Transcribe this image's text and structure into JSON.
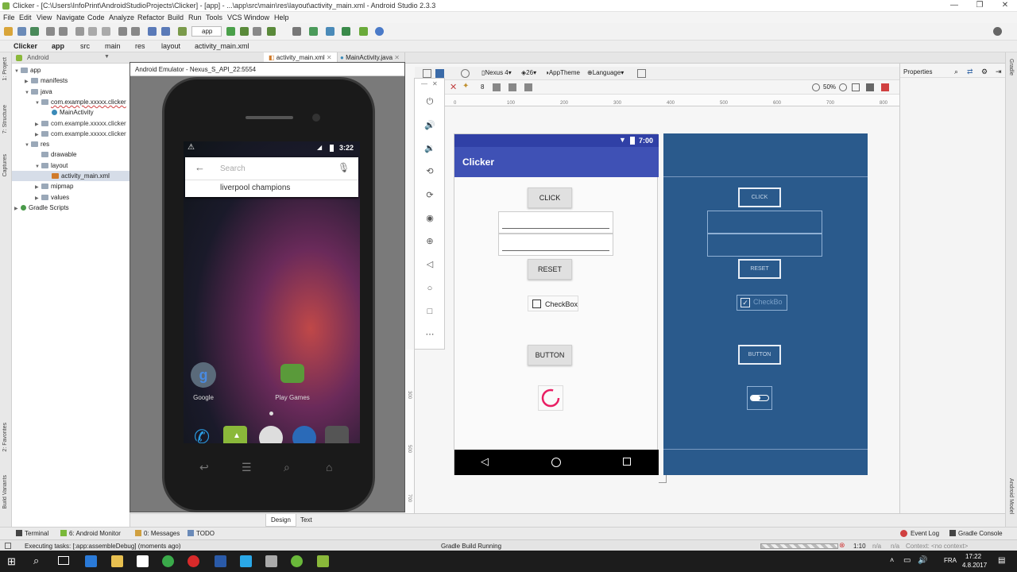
{
  "window": {
    "title": "Clicker - [C:\\Users\\InfoPrint\\AndroidStudioProjects\\Clicker] - [app] - ...\\app\\src\\main\\res\\layout\\activity_main.xml - Android Studio 2.3.3"
  },
  "menu": [
    "File",
    "Edit",
    "View",
    "Navigate",
    "Code",
    "Analyze",
    "Refactor",
    "Build",
    "Run",
    "Tools",
    "VCS",
    "Window",
    "Help"
  ],
  "toolbar": {
    "run_config": "app"
  },
  "breadcrumb": [
    "Clicker",
    "app",
    "src",
    "main",
    "res",
    "layout",
    "activity_main.xml"
  ],
  "project_panel": {
    "view_selector": "Android",
    "tree": [
      {
        "label": "app",
        "level": 0,
        "arrow": "▼"
      },
      {
        "label": "manifests",
        "level": 1,
        "arrow": "▶"
      },
      {
        "label": "java",
        "level": 1,
        "arrow": "▼"
      },
      {
        "label": "com.example.xxxxx.clicker",
        "level": 2,
        "arrow": "▼"
      },
      {
        "label": "MainActivity",
        "level": 3,
        "arrow": ""
      },
      {
        "label": "com.example.xxxxx.clicker",
        "level": 2,
        "arrow": "▶"
      },
      {
        "label": "com.example.xxxxx.clicker",
        "level": 2,
        "arrow": "▶"
      },
      {
        "label": "res",
        "level": 1,
        "arrow": "▼"
      },
      {
        "label": "drawable",
        "level": 2,
        "arrow": ""
      },
      {
        "label": "layout",
        "level": 2,
        "arrow": "▼"
      },
      {
        "label": "activity_main.xml",
        "level": 3,
        "arrow": ""
      },
      {
        "label": "mipmap",
        "level": 2,
        "arrow": "▶"
      },
      {
        "label": "values",
        "level": 2,
        "arrow": "▶"
      },
      {
        "label": "Gradle Scripts",
        "level": 0,
        "arrow": "▶"
      }
    ]
  },
  "left_strip": [
    "1: Project",
    "7: Structure",
    "Captures",
    "2: Favorites",
    "Build Variants"
  ],
  "right_strip": [
    "Gradle",
    "Android Model"
  ],
  "editor_tabs": [
    "activity_main.xml",
    "MainActivity.java"
  ],
  "design_toolbar": {
    "device": "Nexus 4",
    "api": "26",
    "theme": "AppTheme",
    "language": "Language",
    "zoom": "50%",
    "margin": "8"
  },
  "ruler": [
    "0",
    "100",
    "200",
    "300",
    "400",
    "500",
    "600",
    "700",
    "800"
  ],
  "left_ruler": [
    "300",
    "500",
    "700"
  ],
  "preview": {
    "time": "7:00",
    "app_title": "Clicker",
    "click_button": "CLICK",
    "reset_button": "RESET",
    "checkbox": "CheckBox",
    "button": "BUTTON"
  },
  "blueprint": {
    "click": "CLICK",
    "reset": "RESET",
    "checkbox": "CheckBo",
    "button": "BUTTON"
  },
  "properties": {
    "title": "Properties"
  },
  "design_tabs": [
    "Design",
    "Text"
  ],
  "emulator": {
    "title": "Android Emulator - Nexus_S_API_22:5554",
    "time": "3:22",
    "search_placeholder": "Search",
    "suggestion": "liverpool champions",
    "apps": [
      "Google",
      "Play Games"
    ]
  },
  "bottom_tools": [
    "Terminal",
    "6: Android Monitor",
    "0: Messages",
    "TODO",
    "Event Log",
    "Gradle Console"
  ],
  "status": {
    "message": "Executing tasks: [:app:assembleDebug] (moments ago)",
    "center": "Gradle Build Running",
    "position": "1:10",
    "na1": "n/a",
    "na2": "n/a",
    "context": "Context: <no context>"
  },
  "taskbar": {
    "time": "17:22",
    "date": "4.8.2017",
    "lang": "FRA"
  }
}
